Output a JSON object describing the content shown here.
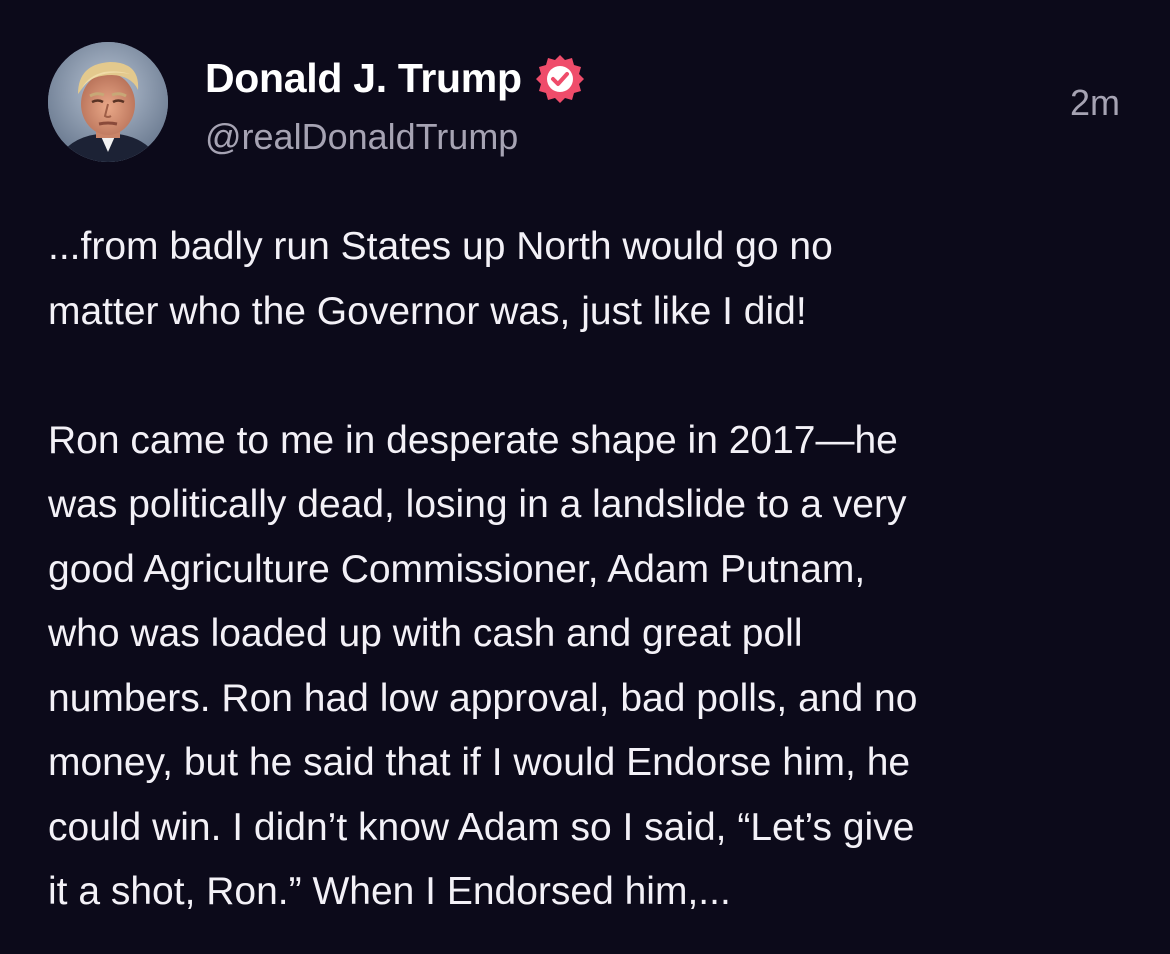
{
  "post": {
    "author": {
      "display_name": "Donald J. Trump",
      "handle": "@realDonaldTrump",
      "verified_icon": "verified-badge-icon",
      "badge_color": "#ef4c6a"
    },
    "timestamp": "2m",
    "paragraphs": [
      {
        "lines": [
          "...from badly run States up North would go no",
          "matter who the Governor was, just like I did!"
        ]
      },
      {
        "lines": [
          "Ron came to me in desperate shape in 2017—he",
          "was politically dead, losing in a landslide to a very",
          "good Agriculture Commissioner, Adam Putnam,",
          "who was loaded up with cash and great poll",
          "numbers. Ron had low approval, bad polls, and no",
          "money, but he said that if I would Endorse him, he",
          "could win. I didn’t know Adam so I said, “Let’s give",
          "it a shot, Ron.” When I Endorsed him,..."
        ]
      }
    ]
  },
  "colors": {
    "background": "#0c0a1a",
    "text": "#f3f1f7",
    "secondary_text": "#a6a3b3",
    "accent": "#ef4c6a"
  }
}
